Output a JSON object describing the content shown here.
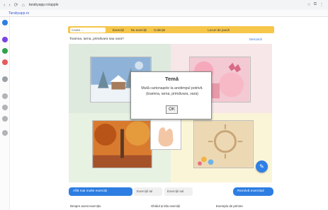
{
  "browser": {
    "url": "tarabyapp.ro/apple",
    "bookmark": "Tarabyapp.ro",
    "nav": [
      "‹",
      "›",
      "⟳",
      "⌂"
    ],
    "right_icons": [
      "☆",
      "⧉",
      "⋮"
    ]
  },
  "toolbar": {
    "search_placeholder": "Cauta ...",
    "buttons": [
      "Exerciții",
      "Nu exerciții",
      "Colecție",
      "Locuri de joacă"
    ]
  },
  "exercise": {
    "question": "Toamna, iarna, primăvara sau vara?",
    "link": "Descarcă"
  },
  "dialog": {
    "title": "Temă",
    "text": "Mută cartonașele la anotimpul potrivit. (toamna, iarna, primăvara, vara)",
    "ok": "OK"
  },
  "bottom_bar": {
    "primary": "Află mai multe exerciții",
    "tab1": "Exerciții tal",
    "tab2": "Exerciții sal",
    "right": "Rezolvă exercițiul"
  },
  "footer": [
    "Despre acest exercițiu",
    "Ghidul și titlu exerciții",
    "Exemplu de primire"
  ],
  "colors": {
    "accent": "#f5c64a",
    "blue": "#2d7de2",
    "quadrant_tl": "#dfeadf",
    "quadrant_tr": "#f7e7e8",
    "quadrant_bl": "#e7f2e3",
    "quadrant_br": "#fbf5d7"
  }
}
